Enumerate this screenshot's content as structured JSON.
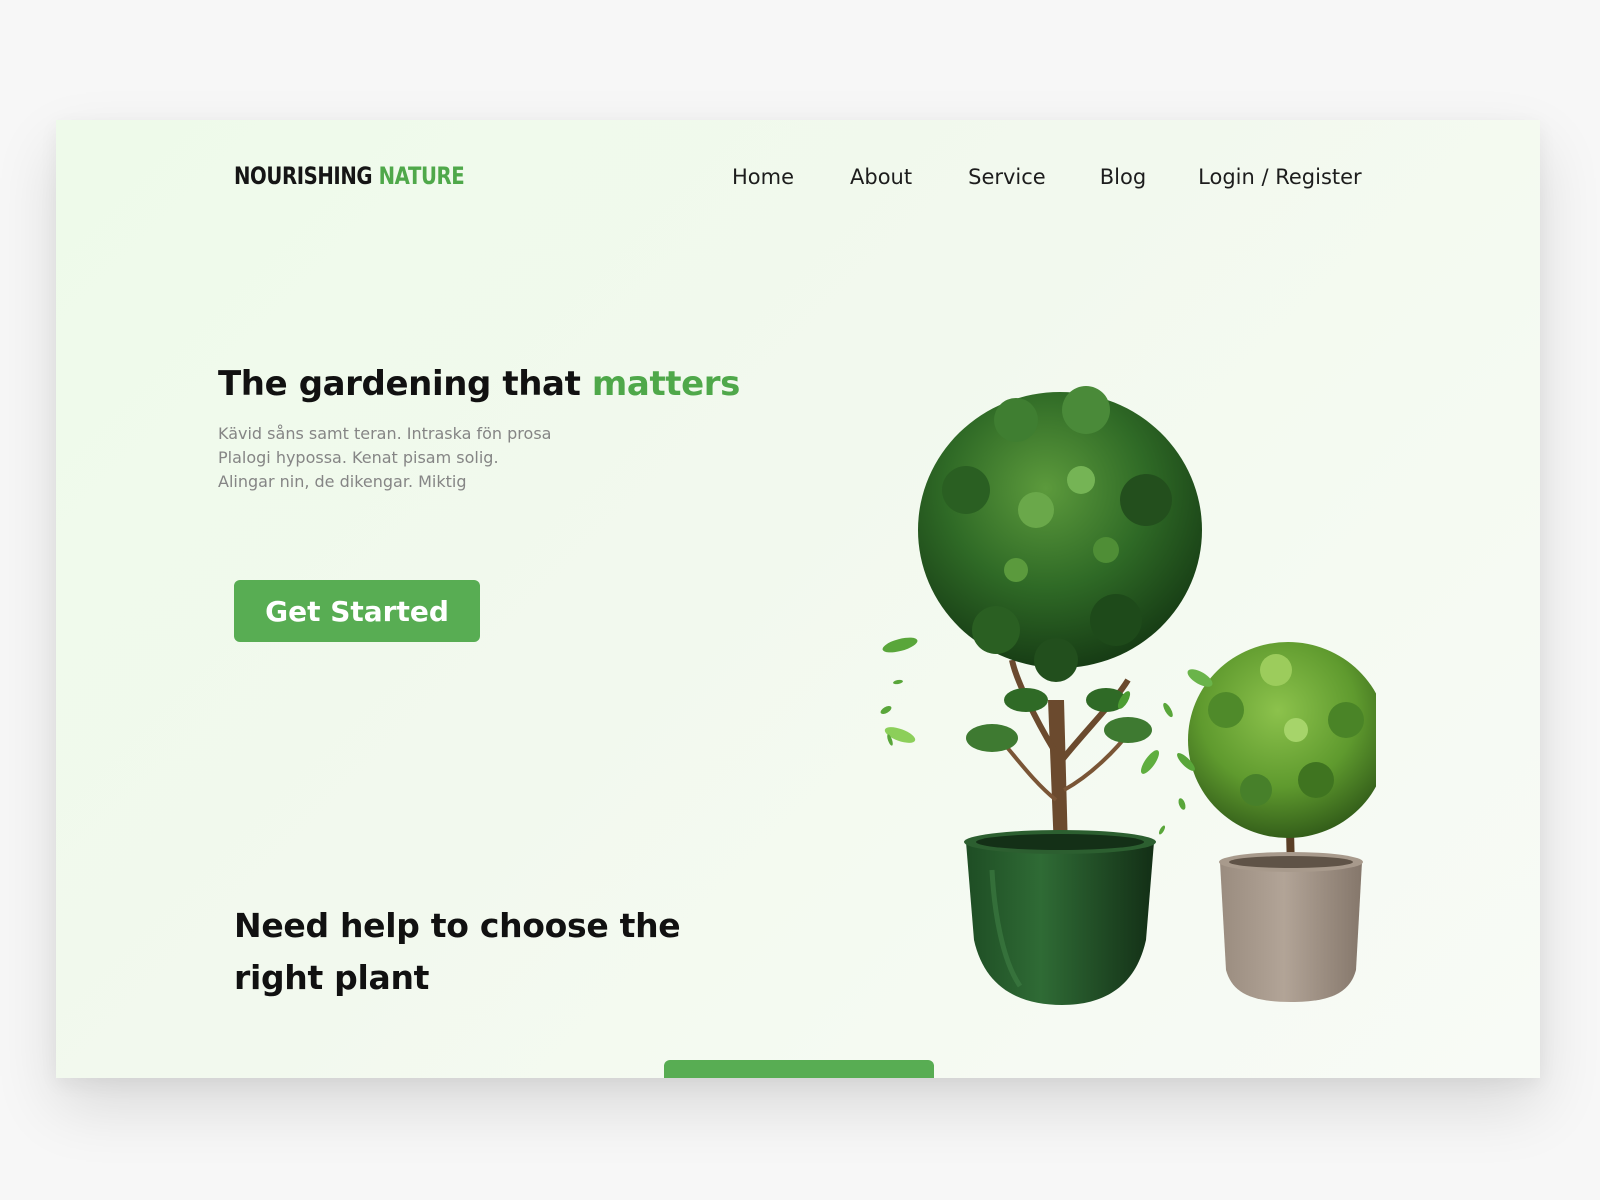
{
  "brand": {
    "part1": "NOURISHING",
    "part2": "NATURE"
  },
  "nav": {
    "home": "Home",
    "about": "About",
    "service": "Service",
    "blog": "Blog",
    "login_register": "Login / Register"
  },
  "hero": {
    "title_main": "The gardening that ",
    "title_accent": "matters",
    "desc_lines": [
      "Kävid såns samt teran. Intraska fön prosa",
      "Plalogi hypossa. Kenat pisam solig.",
      "Alingar nin, de dikengar. Miktig"
    ],
    "cta_label": "Get Started"
  },
  "help": {
    "title_line1": "Need help to choose the",
    "title_line2": "right plant"
  },
  "colors": {
    "accent": "#58ad53",
    "text_dark": "#111111",
    "text_muted": "#858585"
  },
  "image": {
    "subject": "potted-topiary-plants"
  }
}
